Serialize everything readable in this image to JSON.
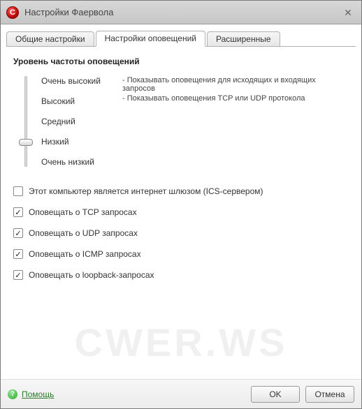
{
  "window": {
    "logo_letter": "C",
    "title": "Настройки Фаервола",
    "close_glyph": "✕"
  },
  "tabs": {
    "general": "Общие настройки",
    "alerts": "Настройки оповещений",
    "advanced": "Расширенные",
    "active_index": 1
  },
  "section": {
    "title": "Уровень частоты оповещений"
  },
  "levels": {
    "items": [
      "Очень высокий",
      "Высокий",
      "Средний",
      "Низкий",
      "Очень низкий"
    ],
    "selected_index": 3
  },
  "descriptions": {
    "line1": "- Показывать оповещения для исходящих и входящих запросов",
    "line2": "- Показывать оповещения TCP или UDP протокола"
  },
  "checkboxes": {
    "ics": {
      "checked": false,
      "label": "Этот компьютер является интернет шлюзом (ICS-сервером)"
    },
    "tcp": {
      "checked": true,
      "label": "Оповещать о TCP запросах"
    },
    "udp": {
      "checked": true,
      "label": "Оповещать о UDP запросах"
    },
    "icmp": {
      "checked": true,
      "label": "Оповещать о ICMP запросах"
    },
    "loopback": {
      "checked": true,
      "label": "Оповещать о loopback-запросах"
    }
  },
  "footer": {
    "help": "Помощь",
    "ok": "OK",
    "cancel": "Отмена"
  },
  "watermark": "CWER.WS"
}
